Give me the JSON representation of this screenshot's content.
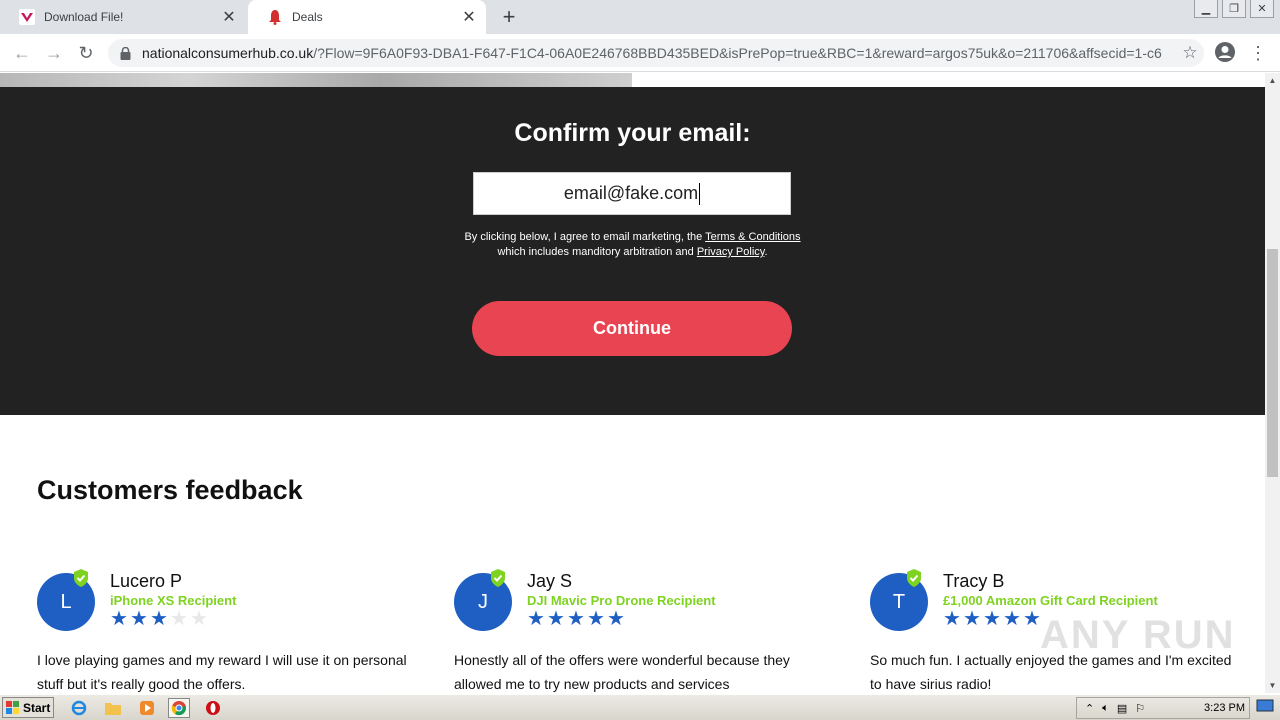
{
  "browser": {
    "tabs": [
      {
        "title": "Download File!",
        "favicon": "v-brand-icon"
      },
      {
        "title": "Deals",
        "favicon": "bell-icon"
      }
    ],
    "url_host": "nationalconsumerhub.co.uk",
    "url_rest": "/?Flow=9F6A0F93-DBA1-F647-F1C4-06A0E246768BBD435BED&isPrePop=true&RBC=1&reward=argos75uk&o=211706&affsecid=1-c6..."
  },
  "form": {
    "title": "Confirm your email:",
    "email_value": "email@fake.com",
    "disclaimer_line1": "By clicking below, I agree to email marketing, the",
    "terms_link": "Terms & Conditions",
    "disclaimer_line2": "which includes manditory arbitration and",
    "privacy_link": "Privacy Policy",
    "continue_label": "Continue",
    "button_color": "#e94452"
  },
  "feedback": {
    "title": "Customers feedback",
    "reviews": [
      {
        "initial": "L",
        "name": "Lucero P",
        "prize": "iPhone XS Recipient",
        "rating": 3,
        "text": "I love playing games and my reward I will use it on personal stuff but it's really good the offers."
      },
      {
        "initial": "J",
        "name": "Jay S",
        "prize": "DJI Mavic Pro Drone Recipient",
        "rating": 5,
        "text": "Honestly all of the offers were wonderful because they allowed me to try new products and services"
      },
      {
        "initial": "T",
        "name": "Tracy B",
        "prize": "£1,000 Amazon Gift Card Recipient",
        "rating": 5,
        "text": "So much fun. I actually enjoyed the games and I'm excited to have sirius radio!"
      }
    ]
  },
  "watermark": "ANY RUN",
  "taskbar": {
    "start_label": "Start",
    "clock": "3:23 PM"
  }
}
